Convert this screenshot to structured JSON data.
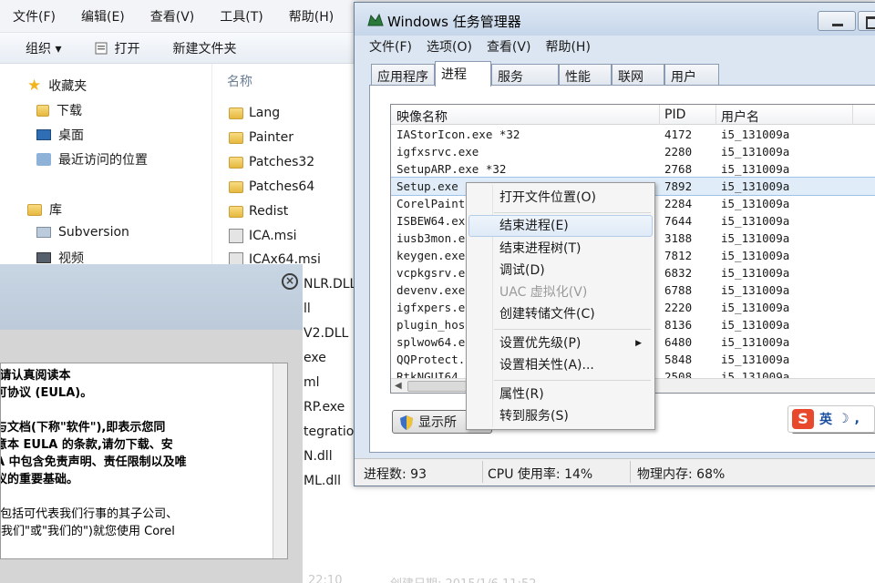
{
  "explorer": {
    "menu": [
      "文件(F)",
      "编辑(E)",
      "查看(V)",
      "工具(T)",
      "帮助(H)"
    ],
    "toolbar": {
      "organize": "组织 ▾",
      "open": "打开",
      "new_folder": "新建文件夹"
    },
    "nav": {
      "favorites": "收藏夹",
      "downloads": "下载",
      "desktop": "桌面",
      "recent": "最近访问的位置",
      "libraries": "库",
      "subversion": "Subversion",
      "videos": "视频"
    },
    "files_header": "名称",
    "files": [
      "Lang",
      "Painter",
      "Patches32",
      "Patches64",
      "Redist",
      "ICA.msi",
      "ICAx64.msi",
      "NLR.DLL",
      "ll",
      "V2.DLL",
      "exe",
      "ml",
      "RP.exe",
      "tegratio",
      "N.dll",
      "ML.dll"
    ],
    "faded_text": {
      "date": "2015/1/6 11:52",
      "time": "22:10",
      "created": "创建日期: 2015/1/6 11:52"
    }
  },
  "setup_dialog": {
    "close_glyph": "×",
    "eula_lines_1": [
      " 请认真阅读本",
      "可协议 (EULA)。"
    ],
    "eula_lines_2": [
      "与文档(下称\"软件\"),即表示您同",
      "意本 EULA 的条款,请勿下载、安",
      "A 中包含免责声明、责任限制以及唯",
      "议的重要基础。"
    ],
    "eula_lines_3": [
      "(包括可代表我们行事的其子公司、",
      "\"我们\"或\"我们的\")就您使用 Corel"
    ]
  },
  "taskmgr": {
    "title": "Windows 任务管理器",
    "menu": [
      "文件(F)",
      "选项(O)",
      "查看(V)",
      "帮助(H)"
    ],
    "tabs": [
      "应用程序",
      "进程",
      "服务",
      "性能",
      "联网",
      "用户"
    ],
    "active_tab": 1,
    "columns": {
      "name": "映像名称",
      "pid": "PID",
      "user": "用户名"
    },
    "processes": [
      {
        "name": "IAStorIcon.exe *32",
        "pid": "4172",
        "user": "i5_131009a"
      },
      {
        "name": "igfxsrvc.exe",
        "pid": "2280",
        "user": "i5_131009a"
      },
      {
        "name": "SetupARP.exe *32",
        "pid": "2768",
        "user": "i5_131009a"
      },
      {
        "name": "Setup.exe *32",
        "pid": "7892",
        "user": "i5_131009a"
      },
      {
        "name": "CorelPaint",
        "pid": "2284",
        "user": "i5_131009a"
      },
      {
        "name": "ISBEW64.exe",
        "pid": "7644",
        "user": "i5_131009a"
      },
      {
        "name": "iusb3mon.e",
        "pid": "3188",
        "user": "i5_131009a"
      },
      {
        "name": "keygen.exe",
        "pid": "7812",
        "user": "i5_131009a"
      },
      {
        "name": "vcpkgsrv.e",
        "pid": "6832",
        "user": "i5_131009a"
      },
      {
        "name": "devenv.exe",
        "pid": "6788",
        "user": "i5_131009a"
      },
      {
        "name": "igfxpers.e",
        "pid": "2220",
        "user": "i5_131009a"
      },
      {
        "name": "plugin_hos",
        "pid": "8136",
        "user": "i5_131009a"
      },
      {
        "name": "splwow64.e",
        "pid": "6480",
        "user": "i5_131009a"
      },
      {
        "name": "QQProtect.",
        "pid": "5848",
        "user": "i5_131009a"
      },
      {
        "name": "RtkNGUI64.",
        "pid": "2508",
        "user": "i5_131009a"
      }
    ],
    "selected_row": 3,
    "show_all_button": "显示所",
    "status": {
      "processes": "进程数: 93",
      "cpu": "CPU 使用率: 14%",
      "memory": "物理内存: 68%"
    }
  },
  "context_menu": {
    "items": [
      {
        "label": "打开文件位置(O)"
      },
      {
        "label": "结束进程(E)"
      },
      {
        "label": "结束进程树(T)"
      },
      {
        "label": "调试(D)"
      },
      {
        "label": "UAC 虚拟化(V)"
      },
      {
        "label": "创建转储文件(C)"
      },
      {
        "label": "设置优先级(P)"
      },
      {
        "label": "设置相关性(A)..."
      },
      {
        "label": "属性(R)"
      },
      {
        "label": "转到服务(S)"
      }
    ],
    "highlighted": "结束进程(E)",
    "disabled": "UAC 虚拟化(V)",
    "submenu_arrow": "▶"
  },
  "ime": {
    "logo": "S",
    "mode": "英",
    "moon": "☽",
    "punct": ","
  },
  "colors": {
    "selection": "#e0edf9",
    "tm_frame": "#dce6f2",
    "sogou": "#e8492d"
  }
}
